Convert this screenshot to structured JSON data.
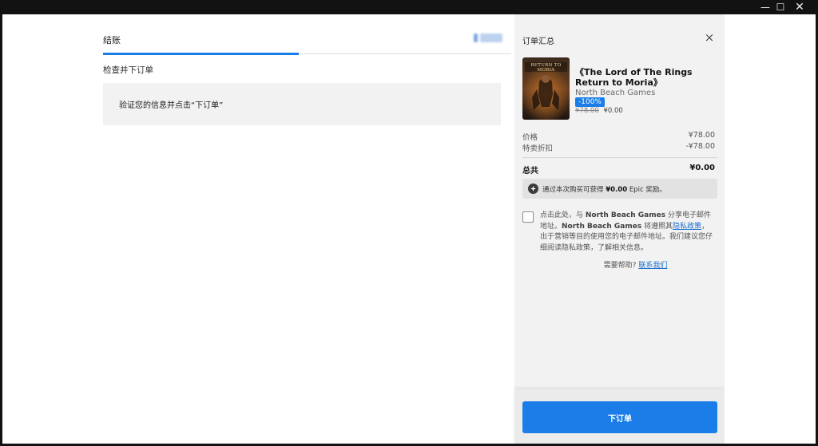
{
  "titlebar": {
    "minimize": "—",
    "maximize": "☐",
    "close": "✕"
  },
  "checkout": {
    "tab_label": "结账",
    "tab_progress": 0.48,
    "section_label": "检查并下订单",
    "verify_message": "验证您的信息并点击“下订单”"
  },
  "summary": {
    "title": "订单汇总",
    "close_icon": "×",
    "product": {
      "title": "《The Lord of The Rings Return to Moria》",
      "publisher": "North Beach Games",
      "discount_badge": "-100%",
      "original_price": "¥78.00",
      "sale_price": "¥0.00",
      "cover_logo_text": "RETURN TO MORIA"
    },
    "rows": [
      {
        "label": "价格",
        "value": "¥78.00"
      },
      {
        "label": "特卖折扣",
        "value": "-¥78.00"
      }
    ],
    "total_label": "总共",
    "total_value": "¥0.00",
    "reward": {
      "prefix": "通过本次购买可获得",
      "amount": "¥0.00",
      "suffix": "Epic 奖励。"
    },
    "consent": {
      "part1": "点击此处，与",
      "publisher1": "North Beach Games",
      "part2": "分享电子邮件地址。",
      "publisher2": "North Beach Games",
      "part3": "将遵照其",
      "privacy_link": "隐私政策",
      "part4": "，出于营销等目的使用您的电子邮件地址。我们建议您仔细阅读隐私政策，了解相关信息。"
    },
    "help_prefix": "需要帮助?",
    "help_link": "联系我们",
    "place_order_label": "下订单"
  },
  "colors": {
    "accent": "#1a7de8",
    "panel": "#f2f2f2",
    "titlebar": "#121212"
  }
}
